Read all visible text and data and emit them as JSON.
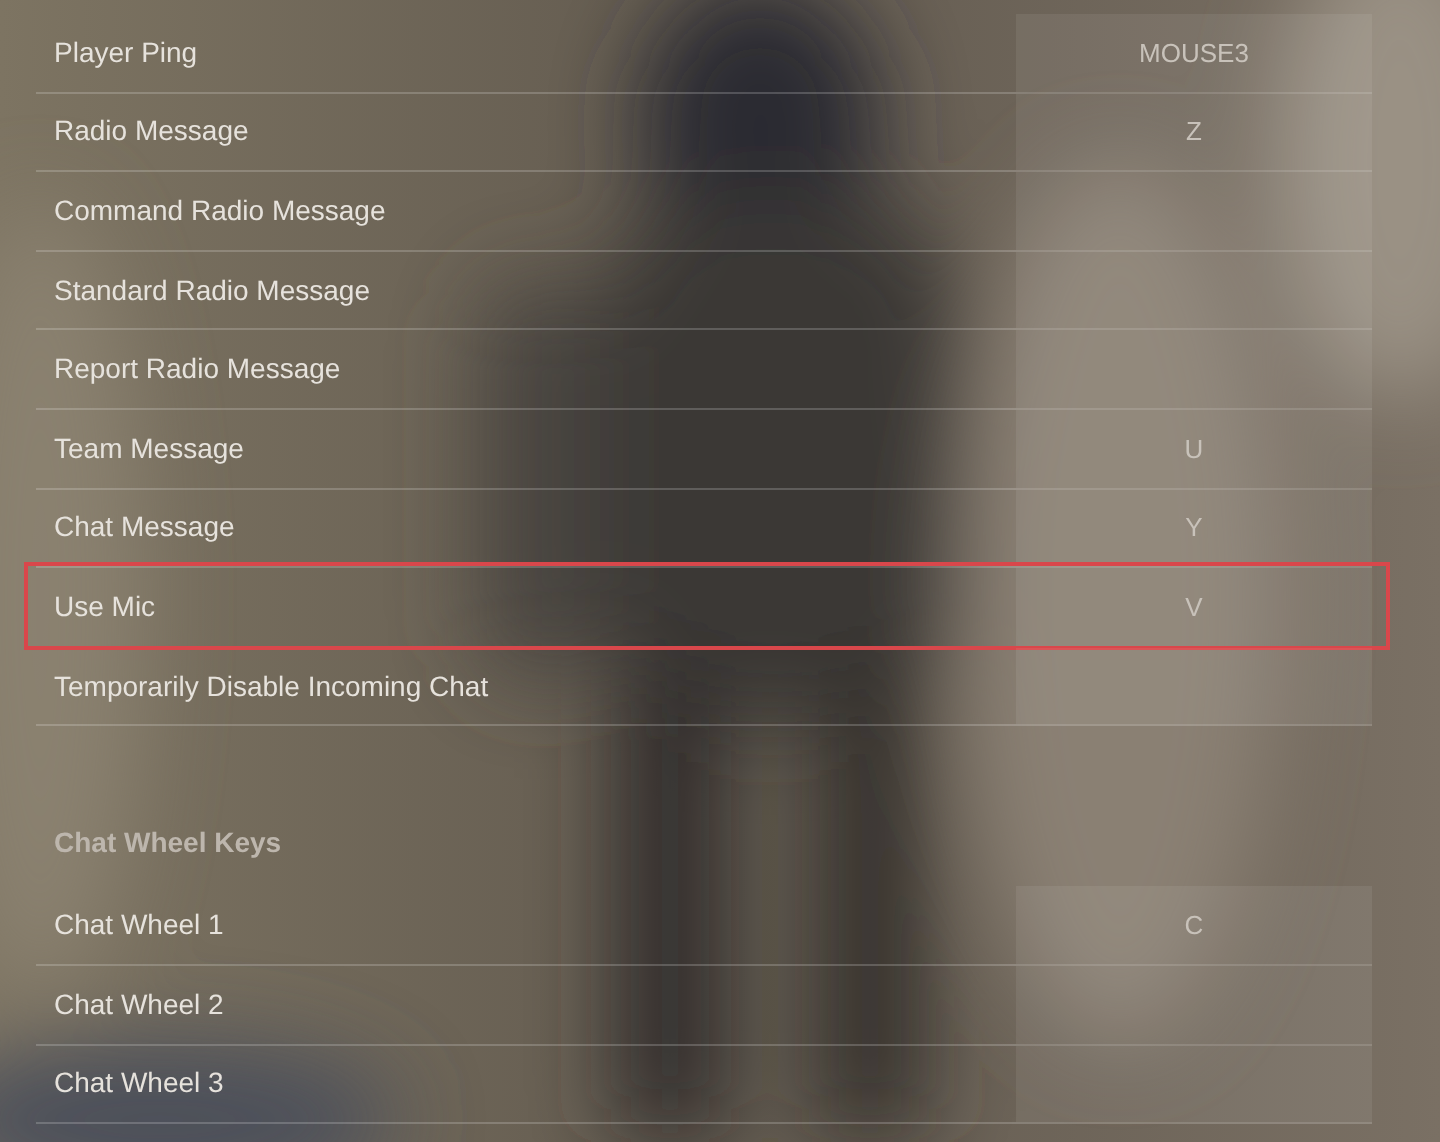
{
  "sections": [
    {
      "rows": [
        {
          "label": "Player Ping",
          "key": "MOUSE3",
          "highlighted": false
        },
        {
          "label": "Radio Message",
          "key": "Z",
          "highlighted": false
        },
        {
          "label": "Command Radio Message",
          "highlighted": false
        },
        {
          "label": "Standard Radio Message",
          "highlighted": false
        },
        {
          "label": "Report Radio Message",
          "highlighted": false
        },
        {
          "label": "Team Message",
          "key": "U",
          "highlighted": false
        },
        {
          "label": "Chat Message",
          "key": "Y",
          "highlighted": false
        },
        {
          "label": "Use Mic",
          "key": "V",
          "highlighted": true
        },
        {
          "label": "Temporarily Disable Incoming Chat",
          "highlighted": false
        }
      ]
    },
    {
      "title": "Chat Wheel Keys",
      "rows": [
        {
          "label": "Chat Wheel 1",
          "key": "C",
          "highlighted": false
        },
        {
          "label": "Chat Wheel 2",
          "highlighted": false
        },
        {
          "label": "Chat Wheel 3",
          "highlighted": false
        }
      ]
    }
  ]
}
